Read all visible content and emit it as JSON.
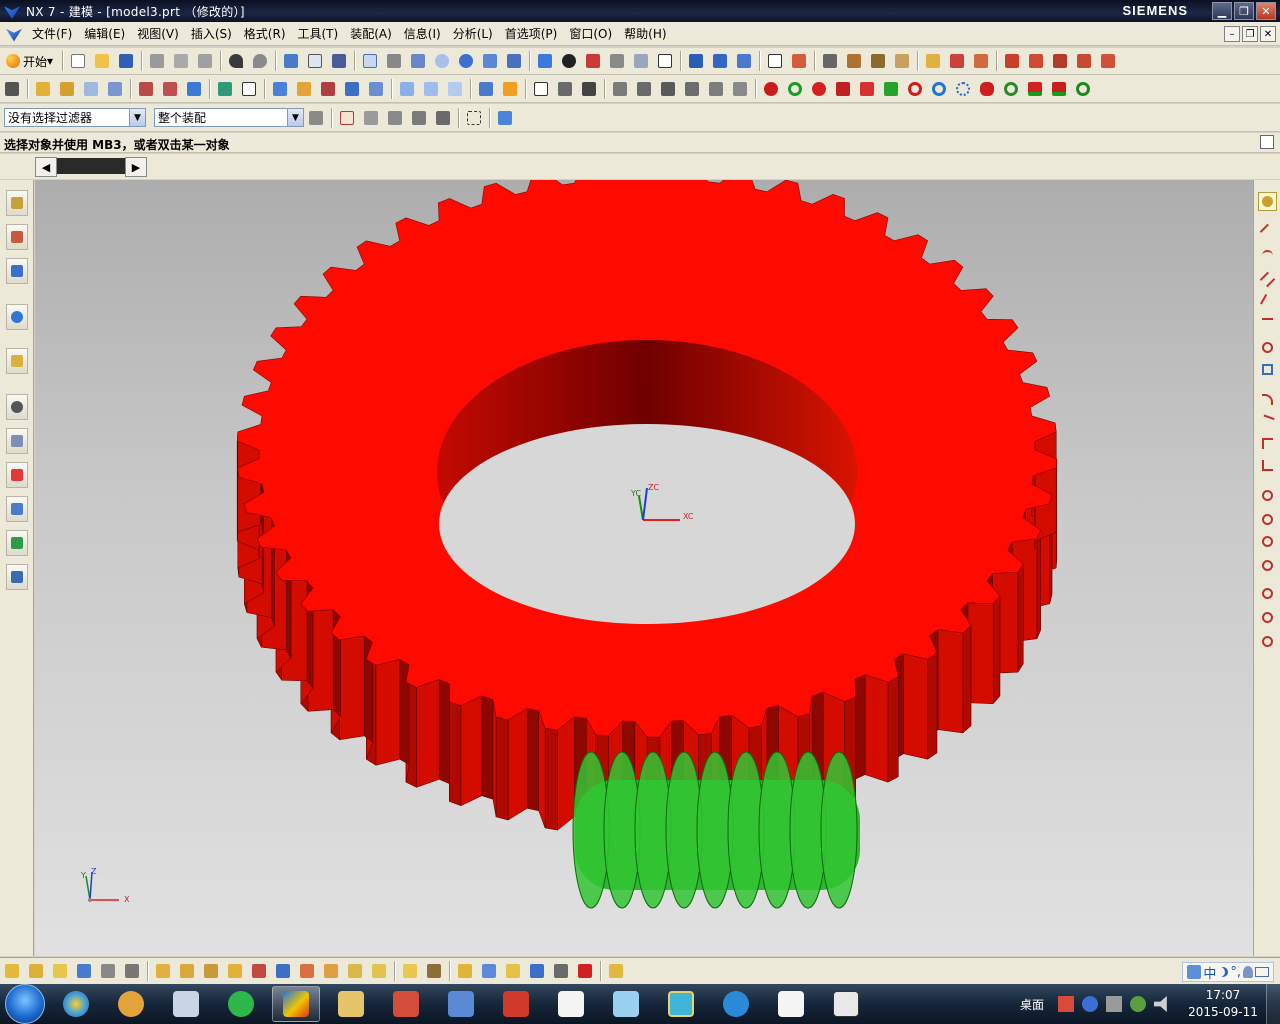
{
  "window": {
    "title": "NX 7 - 建模 - [model3.prt （修改的）]",
    "brand": "SIEMENS",
    "btn_min": "▁",
    "btn_max": "❐",
    "btn_close": "✕"
  },
  "menu": {
    "items": [
      "文件(F)",
      "编辑(E)",
      "视图(V)",
      "插入(S)",
      "格式(R)",
      "工具(T)",
      "装配(A)",
      "信息(I)",
      "分析(L)",
      "首选项(P)",
      "窗口(O)",
      "帮助(H)"
    ],
    "doc_min": "–",
    "doc_restore": "❐",
    "doc_close": "✕"
  },
  "toolbar": {
    "start_label": "开始",
    "start_arrow": "▾"
  },
  "selection": {
    "filter_value": "没有选择过滤器",
    "scope_value": "整个装配",
    "arrow": "▼"
  },
  "cue": {
    "text": "选择对象并使用 MB3，或者双击某一对象"
  },
  "tabs": {
    "prev": "◀",
    "next": "▶"
  },
  "viewport": {
    "wcs": {
      "x_label": "XC",
      "y_label": "YC",
      "z_label": "ZC"
    },
    "absolute_csys": {
      "x_label": "X",
      "y_label": "Y",
      "z_label": "Z"
    },
    "gear_color": "#ff0a00",
    "gear_side_color": "#c80a00",
    "worm_color": "#33c633"
  },
  "ime": {
    "lang": "中",
    "extra": "°,"
  },
  "taskbar": {
    "desktop_label": "桌面",
    "time": "17:07",
    "date": "2015-09-11"
  }
}
